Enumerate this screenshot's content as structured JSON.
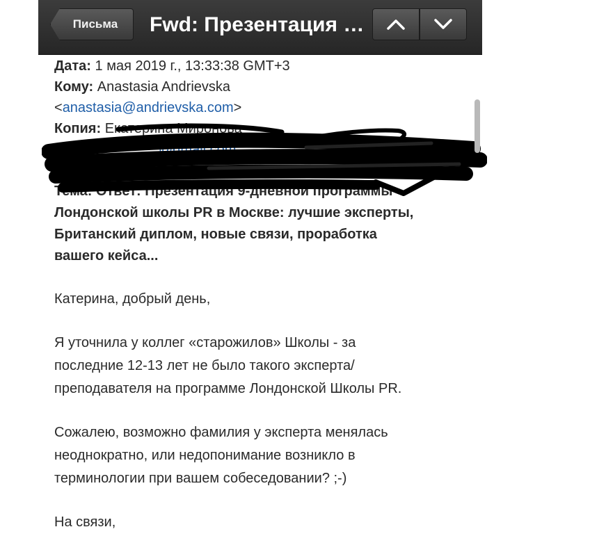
{
  "topbar": {
    "back_label": "Письма",
    "title": "Fwd: Презентация 9-..."
  },
  "icons": {
    "up": "chevron-up-icon",
    "down": "chevron-down-icon"
  },
  "header_fields": {
    "date_label": "Дата:",
    "date_value": "1 мая 2019 г., 13:33:38 GMT+3",
    "to_label": "Кому:",
    "to_name": "Anastasia Andrievska",
    "to_email_open": "<",
    "to_email": "anastasia@andrievska.com",
    "to_email_close": ">",
    "cc_label": "Копия:",
    "cc_name": "Екатерина Миронова",
    "cc_email": "@gmail.com",
    "subject_lines": [
      "Тема: Ответ: Презентация 9-дневной программы",
      "Лондонской школы PR в Москве: лучшие эксперты,",
      "Британский диплом, новые связи, проработка",
      "вашего кейса..."
    ]
  },
  "body": {
    "greeting": "Катерина, добрый день,",
    "para1": [
      "Я уточнила у коллег  «старожилов» Школы - за",
      "последние 12-13 лет не было такого эксперта/",
      "преподавателя на программе Лондонской Школы PR."
    ],
    "para2": [
      "Сожалею, возможно фамилия у эксперта менялась",
      "неоднократно, или недопонимание возникло в",
      "терминологии при вашем собеседовании? ;-)"
    ],
    "closing": "На связи,"
  }
}
